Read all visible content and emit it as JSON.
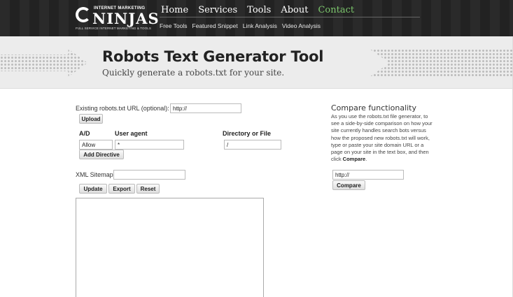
{
  "header": {
    "logo": {
      "top_text": "INTERNET MARKETING",
      "main_text": "NINJAS",
      "sub_text": "FULL SERVICE INTERNET MARKETING & TOOLS"
    },
    "nav": [
      "Home",
      "Services",
      "Tools",
      "About",
      "Contact"
    ],
    "subnav": [
      "Free Tools",
      "Featured Snippet",
      "Link Analysis",
      "Video Analysis"
    ]
  },
  "banner": {
    "title": "Robots Text Generator Tool",
    "subtitle": "Quickly generate a robots.txt for your site."
  },
  "form": {
    "existing_label": "Existing robots.txt URL (optional):",
    "existing_value": "http://",
    "upload_label": "Upload",
    "col_ad": "A/D",
    "col_agent": "User agent",
    "col_dir": "Directory or File",
    "ad_value": "Allow",
    "agent_value": "*",
    "dir_value": "/",
    "add_directive_label": "Add Directive",
    "xml_sitemap_label": "XML Sitemap",
    "xml_sitemap_value": "",
    "update_label": "Update",
    "export_label": "Export",
    "reset_label": "Reset",
    "output_text": ""
  },
  "compare": {
    "title": "Compare functionality",
    "text_before": "As you use the robots.txt file generator, to see a side-by-side comparison on how your site currently handles search bots versus how the proposed new robots.txt will work, type or paste your site domain URL or a page on your site in the text box, and then click ",
    "text_bold": "Compare",
    "text_after": ".",
    "url_value": "http://",
    "button_label": "Compare"
  }
}
